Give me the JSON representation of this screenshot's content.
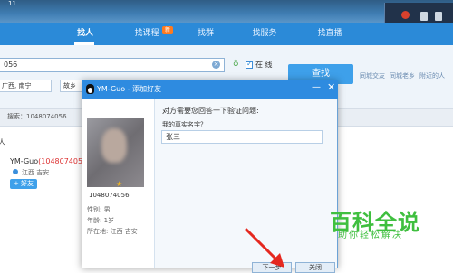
{
  "desktop": {
    "num": "11"
  },
  "tabs": [
    {
      "label": "找人"
    },
    {
      "label": "找课程"
    },
    {
      "label": "找群"
    },
    {
      "label": "找服务"
    },
    {
      "label": "找直播"
    }
  ],
  "new_badge": "新",
  "search": {
    "value": "056",
    "online_label": "在 线",
    "button": "查找"
  },
  "filters": {
    "region": "广西, 南宁",
    "hometown": "故乡"
  },
  "side_links": [
    "同城交友",
    "同城老乡",
    "附近的人"
  ],
  "result": {
    "text": "搜索：1048074056"
  },
  "section_label": "人",
  "user": {
    "name": "YM-Guo",
    "id": "(1048074056)",
    "location": "江西  吉安",
    "add_button": "+ 好友"
  },
  "dialog": {
    "title": "YM-Guo - 添加好友",
    "question_title": "对方需要您回答一下验证问题:",
    "question": "我的真实名字？",
    "answer": "张三",
    "profile": {
      "number": "1048074056",
      "gender": "性别: 男",
      "age": "年龄: 1岁",
      "location": "所在地: 江西  吉安"
    },
    "next_button": "下一步",
    "cancel_button": "关闭"
  },
  "watermark": {
    "main": "百科全说",
    "sub": "助你轻松解决"
  },
  "colors": {
    "accent": "#2b8ad8",
    "watermark": "#3fbf3f",
    "id_red": "#dd3333"
  }
}
